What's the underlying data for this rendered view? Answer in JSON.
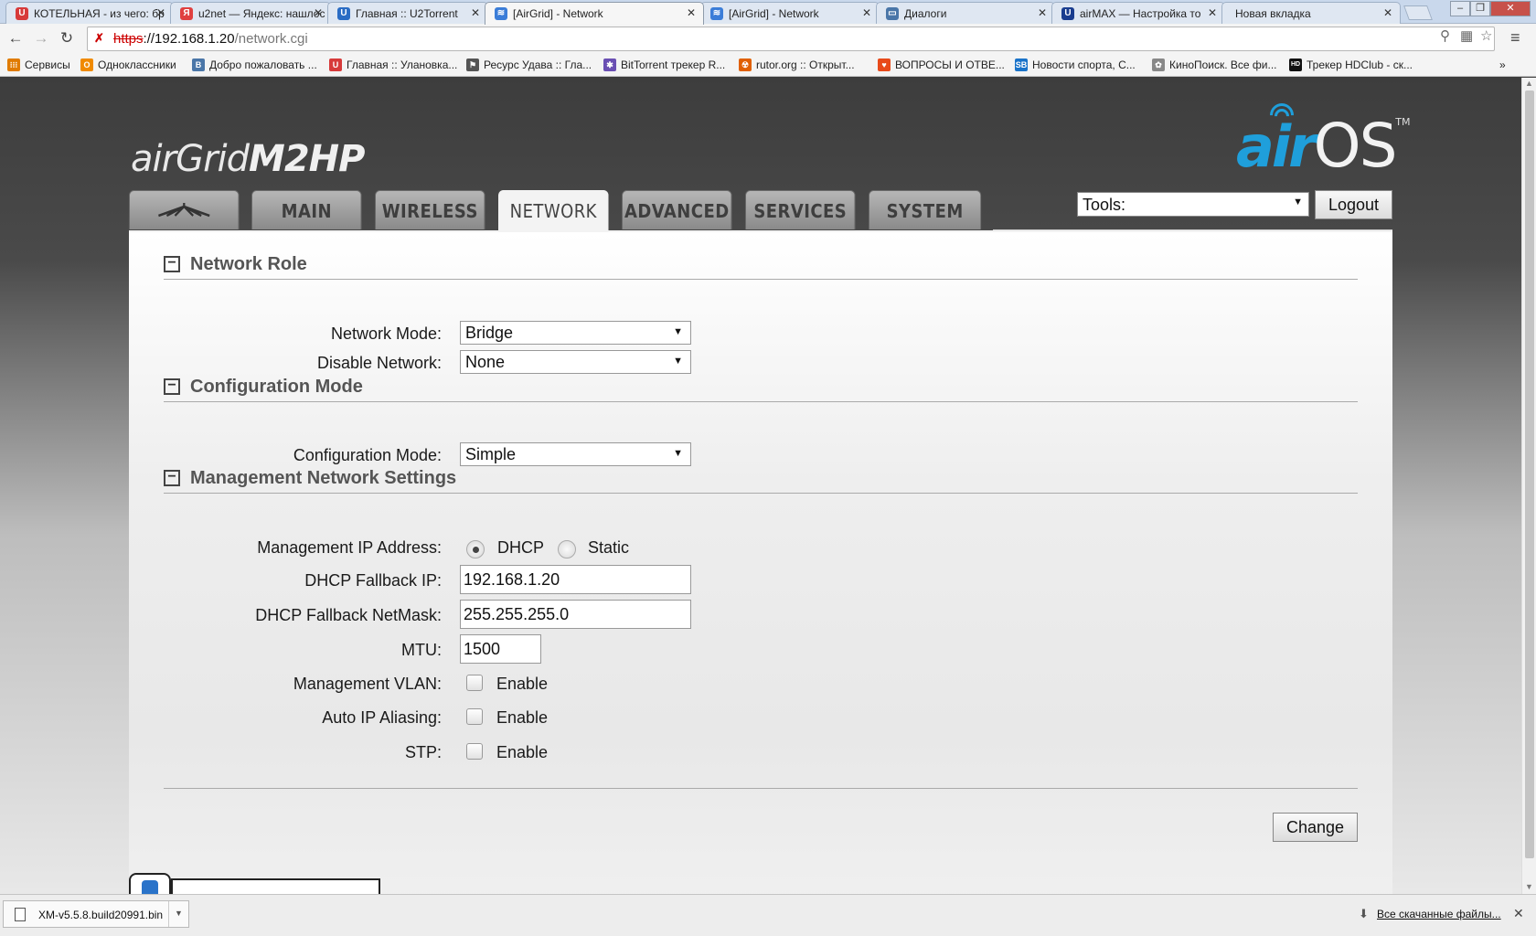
{
  "browser": {
    "tabs": [
      {
        "title": "КОТЕЛЬНАЯ - из чего: бр",
        "icon_color": "#d73a3a",
        "icon_glyph": "U"
      },
      {
        "title": "u2net — Яндекс: нашлос",
        "icon_color": "#e04040",
        "icon_glyph": "Я"
      },
      {
        "title": "Главная :: U2Torrent",
        "icon_color": "#2a6cc4",
        "icon_glyph": "U"
      },
      {
        "title": "[AirGrid] - Network",
        "icon_color": "#3b7dd8",
        "icon_glyph": "≋"
      },
      {
        "title": "[AirGrid] - Network",
        "icon_color": "#3b7dd8",
        "icon_glyph": "≋"
      },
      {
        "title": "Диалоги",
        "icon_color": "#4a76a8",
        "icon_glyph": "▭"
      },
      {
        "title": "airMAX — Настройка то",
        "icon_color": "#1a3d8f",
        "icon_glyph": "U"
      },
      {
        "title": "Новая вкладка",
        "icon_color": "",
        "icon_glyph": ""
      }
    ],
    "active_tab_index": 3,
    "url": {
      "scheme": "https",
      "rest": "://192.168.1.20",
      "path": "/network.cgi"
    },
    "bookmarks": [
      {
        "label": "Сервисы",
        "icon_color": "#e07b00",
        "icon_glyph": "⁝⁝⁝"
      },
      {
        "label": "Одноклассники",
        "icon_color": "#f08a00",
        "icon_glyph": "О"
      },
      {
        "label": "Добро пожаловать ...",
        "icon_color": "#4a76a8",
        "icon_glyph": "В"
      },
      {
        "label": "Главная :: Улановка...",
        "icon_color": "#d73a3a",
        "icon_glyph": "U"
      },
      {
        "label": "Ресурс Удава :: Гла...",
        "icon_color": "#555555",
        "icon_glyph": "⚑"
      },
      {
        "label": "BitTorrent трекер R...",
        "icon_color": "#6a4fb3",
        "icon_glyph": "✱"
      },
      {
        "label": "rutor.org :: Открыт...",
        "icon_color": "#e06000",
        "icon_glyph": "☢"
      },
      {
        "label": "ВОПРОСЫ И ОТВЕ...",
        "icon_color": "#e84a1a",
        "icon_glyph": "♥"
      },
      {
        "label": "Новости спорта, С...",
        "icon_color": "#1a73c9",
        "icon_glyph": "SB"
      },
      {
        "label": "КиноПоиск. Все фи...",
        "icon_color": "#888888",
        "icon_glyph": "✿"
      },
      {
        "label": "Трекер HDClub - ск...",
        "icon_color": "#111111",
        "icon_glyph": "HD"
      }
    ],
    "more_bookmarks": "»"
  },
  "page": {
    "logo_left": {
      "air": "air",
      "grid": "Grid",
      "model": "M2HP"
    },
    "logo_right": {
      "air": "air",
      "os": "OS",
      "tm": "TM"
    },
    "nav_tabs": [
      "MAIN",
      "WIRELESS",
      "NETWORK",
      "ADVANCED",
      "SERVICES",
      "SYSTEM"
    ],
    "active_nav": "NETWORK",
    "tools": {
      "value": "Tools:"
    },
    "logout_label": "Logout",
    "sections": {
      "network_role": "Network Role",
      "configuration_mode": "Configuration Mode",
      "management": "Management Network Settings"
    },
    "fields": {
      "network_mode": {
        "label": "Network Mode:",
        "value": "Bridge"
      },
      "disable_network": {
        "label": "Disable Network:",
        "value": "None"
      },
      "configuration_mode": {
        "label": "Configuration Mode:",
        "value": "Simple"
      },
      "mgmt_ip": {
        "label": "Management IP Address:",
        "dhcp": "DHCP",
        "static": "Static",
        "selected": "DHCP"
      },
      "dhcp_fallback_ip": {
        "label": "DHCP Fallback IP:",
        "value": "192.168.1.20"
      },
      "dhcp_fallback_netmask": {
        "label": "DHCP Fallback NetMask:",
        "value": "255.255.255.0"
      },
      "mtu": {
        "label": "MTU:",
        "value": "1500"
      },
      "mgmt_vlan": {
        "label": "Management VLAN:",
        "option": "Enable",
        "checked": false
      },
      "auto_ip_aliasing": {
        "label": "Auto IP Aliasing:",
        "option": "Enable",
        "checked": false
      },
      "stp": {
        "label": "STP:",
        "option": "Enable",
        "checked": false
      }
    },
    "change_label": "Change",
    "accent_color": "#1f9fdb"
  },
  "downloads": {
    "file": "XM-v5.5.8.build20991.bin",
    "all_label": "Все скачанные файлы..."
  }
}
